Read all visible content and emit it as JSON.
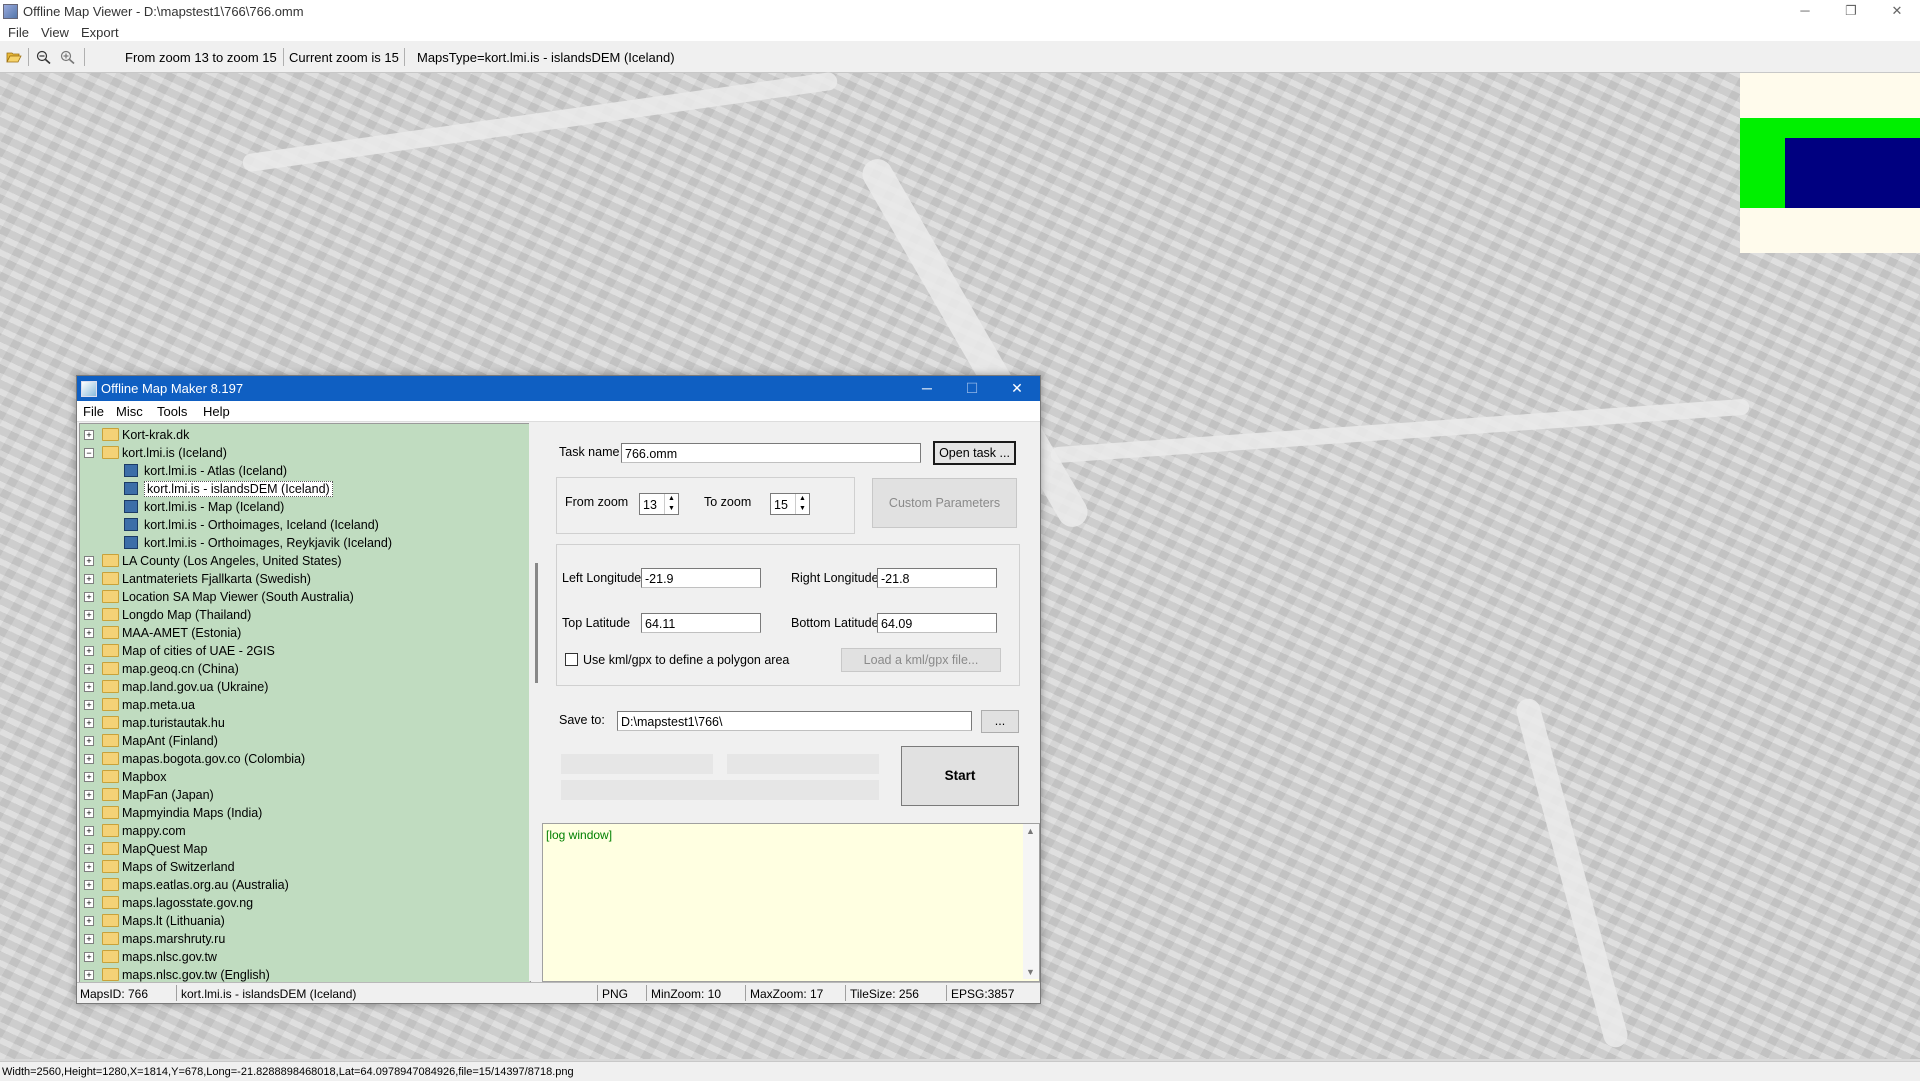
{
  "window": {
    "title": "Offline Map Viewer - D:\\mapstest1\\766\\766.omm"
  },
  "menubar": [
    "File",
    "View",
    "Export"
  ],
  "toolbar": {
    "zoom_range": "From zoom 13 to zoom 15",
    "current_zoom": "Current zoom is 15",
    "maps_type": "MapsType=kort.lmi.is - islandsDEM (Iceland)"
  },
  "statusbar": {
    "text": "Width=2560,Height=1280,X=1814,Y=678,Long=-21.8288898468018,Lat=64.0978947084926,file=15/14397/8718.png"
  },
  "minimap": {
    "colors": {
      "background": "#fffbec",
      "covered": "#00f000",
      "viewport": "#000080"
    }
  },
  "dialog": {
    "title": "Offline Map Maker 8.197",
    "menu": [
      "File",
      "Misc",
      "Tools",
      "Help"
    ],
    "tree": [
      {
        "label": "Kort-krak.dk",
        "level": 0,
        "expanded": false,
        "type": "folder"
      },
      {
        "label": "kort.lmi.is (Iceland)",
        "level": 0,
        "expanded": true,
        "type": "folder-open"
      },
      {
        "label": "kort.lmi.is - Atlas (Iceland)",
        "level": 1,
        "type": "map"
      },
      {
        "label": "kort.lmi.is - islandsDEM (Iceland)",
        "level": 1,
        "type": "map",
        "selected": true
      },
      {
        "label": "kort.lmi.is - Map (Iceland)",
        "level": 1,
        "type": "map"
      },
      {
        "label": "kort.lmi.is - Orthoimages, Iceland (Iceland)",
        "level": 1,
        "type": "map"
      },
      {
        "label": "kort.lmi.is - Orthoimages, Reykjavik (Iceland)",
        "level": 1,
        "type": "map"
      },
      {
        "label": "LA County (Los Angeles, United States)",
        "level": 0,
        "type": "folder"
      },
      {
        "label": "Lantmateriets Fjallkarta (Swedish)",
        "level": 0,
        "type": "folder"
      },
      {
        "label": "Location SA Map Viewer (South Australia)",
        "level": 0,
        "type": "folder"
      },
      {
        "label": "Longdo Map (Thailand)",
        "level": 0,
        "type": "folder"
      },
      {
        "label": "MAA-AMET (Estonia)",
        "level": 0,
        "type": "folder"
      },
      {
        "label": "Map of cities of UAE - 2GIS",
        "level": 0,
        "type": "folder"
      },
      {
        "label": "map.geoq.cn (China)",
        "level": 0,
        "type": "folder"
      },
      {
        "label": "map.land.gov.ua (Ukraine)",
        "level": 0,
        "type": "folder"
      },
      {
        "label": "map.meta.ua",
        "level": 0,
        "type": "folder"
      },
      {
        "label": "map.turistautak.hu",
        "level": 0,
        "type": "folder"
      },
      {
        "label": "MapAnt (Finland)",
        "level": 0,
        "type": "folder"
      },
      {
        "label": "mapas.bogota.gov.co (Colombia)",
        "level": 0,
        "type": "folder"
      },
      {
        "label": "Mapbox",
        "level": 0,
        "type": "folder"
      },
      {
        "label": "MapFan (Japan)",
        "level": 0,
        "type": "folder"
      },
      {
        "label": "Mapmyindia Maps (India)",
        "level": 0,
        "type": "folder"
      },
      {
        "label": "mappy.com",
        "level": 0,
        "type": "folder"
      },
      {
        "label": "MapQuest Map",
        "level": 0,
        "type": "folder"
      },
      {
        "label": "Maps of Switzerland",
        "level": 0,
        "type": "folder"
      },
      {
        "label": "maps.eatlas.org.au (Australia)",
        "level": 0,
        "type": "folder"
      },
      {
        "label": "maps.lagosstate.gov.ng",
        "level": 0,
        "type": "folder"
      },
      {
        "label": "Maps.lt (Lithuania)",
        "level": 0,
        "type": "folder"
      },
      {
        "label": "maps.marshruty.ru",
        "level": 0,
        "type": "folder"
      },
      {
        "label": "maps.nlsc.gov.tw",
        "level": 0,
        "type": "folder"
      },
      {
        "label": "maps.nlsc.gov.tw (English)",
        "level": 0,
        "type": "folder"
      }
    ],
    "form": {
      "task_name_label": "Task name",
      "task_name_value": "766.omm",
      "open_task_label": "Open task ...",
      "from_zoom_label": "From zoom",
      "from_zoom_value": "13",
      "to_zoom_label": "To zoom",
      "to_zoom_value": "15",
      "custom_params_label": "Custom Parameters",
      "left_lon_label": "Left Longitude",
      "left_lon_value": "-21.9",
      "right_lon_label": "Right Longitude",
      "right_lon_value": "-21.8",
      "top_lat_label": "Top Latitude",
      "top_lat_value": "64.11",
      "bottom_lat_label": "Bottom Latitude",
      "bottom_lat_value": "64.09",
      "kml_checkbox_label": "Use kml/gpx to define a polygon area",
      "load_kml_label": "Load a kml/gpx file...",
      "save_to_label": "Save to:",
      "save_to_value": "D:\\mapstest1\\766\\",
      "browse_label": "...",
      "start_label": "Start"
    },
    "log": {
      "text": "[log window]"
    },
    "status": {
      "maps_id": "MapsID: 766",
      "map_name": "kort.lmi.is - islandsDEM (Iceland)",
      "format": "PNG",
      "min_zoom": "MinZoom: 10",
      "max_zoom": "MaxZoom: 17",
      "tile_size": "TileSize: 256",
      "epsg": "EPSG:3857"
    }
  }
}
